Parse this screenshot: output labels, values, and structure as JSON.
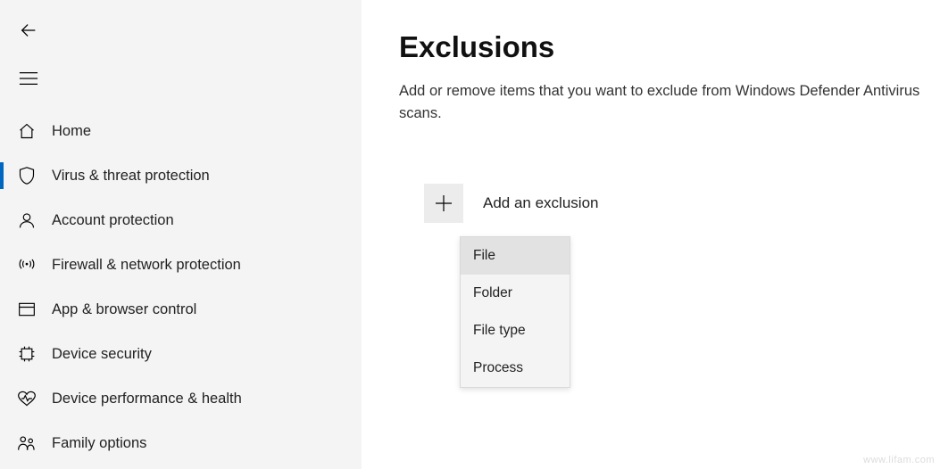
{
  "sidebar": {
    "items": [
      {
        "label": "Home"
      },
      {
        "label": "Virus & threat protection"
      },
      {
        "label": "Account protection"
      },
      {
        "label": "Firewall & network protection"
      },
      {
        "label": "App & browser control"
      },
      {
        "label": "Device security"
      },
      {
        "label": "Device performance & health"
      },
      {
        "label": "Family options"
      }
    ]
  },
  "page": {
    "title": "Exclusions",
    "description": "Add or remove items that you want to exclude from Windows Defender Antivirus scans."
  },
  "add": {
    "label": "Add an exclusion"
  },
  "dropdown": {
    "items": [
      {
        "label": "File"
      },
      {
        "label": "Folder"
      },
      {
        "label": "File type"
      },
      {
        "label": "Process"
      }
    ]
  },
  "watermark": "www.lifam.com"
}
